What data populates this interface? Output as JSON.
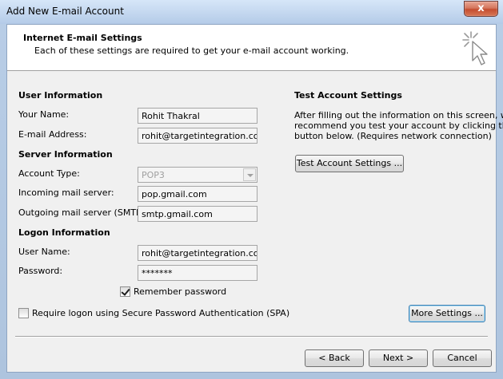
{
  "window": {
    "title": "Add New E-mail Account",
    "close_glyph": "x"
  },
  "header": {
    "title": "Internet E-mail Settings",
    "subtitle": "Each of these settings are required to get your e-mail account working.",
    "icon": "cursor-sparkle-icon"
  },
  "user_info": {
    "heading": "User Information",
    "name_label": "Your Name:",
    "name_value": "Rohit Thakral",
    "email_label": "E-mail Address:",
    "email_value": "rohit@targetintegration.com"
  },
  "server_info": {
    "heading": "Server Information",
    "account_type_label": "Account Type:",
    "account_type_value": "POP3",
    "incoming_label": "Incoming mail server:",
    "incoming_value": "pop.gmail.com",
    "outgoing_label": "Outgoing mail server (SMTP):",
    "outgoing_value": "smtp.gmail.com"
  },
  "logon_info": {
    "heading": "Logon Information",
    "username_label": "User Name:",
    "username_value": "rohit@targetintegration.com",
    "password_label": "Password:",
    "password_value": "*******",
    "remember_label": "Remember password",
    "remember_checked": true,
    "spa_label": "Require logon using Secure Password Authentication (SPA)",
    "spa_checked": false
  },
  "test": {
    "heading": "Test Account Settings",
    "description_1": "After filling out the information on this screen, we",
    "description_2": "recommend you test your account by clicking the",
    "description_3": "button below. (Requires network connection)",
    "button": "Test Account Settings ..."
  },
  "buttons": {
    "more_settings": "More Settings ...",
    "back": "< Back",
    "next": "Next >",
    "cancel": "Cancel"
  }
}
